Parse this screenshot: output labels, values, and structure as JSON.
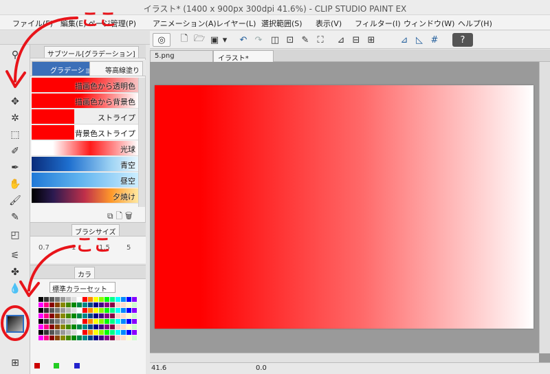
{
  "window": {
    "title": "イラスト* (1400 x 900px 300dpi 41.6%)  - CLIP STUDIO PAINT EX"
  },
  "menu": [
    "ファイル(F)",
    "編集(E)",
    "ページ管理(P)",
    "アニメーション(A)",
    "レイヤー(L)",
    "選択範囲(S)",
    "表示(V)",
    "フィルター(I)",
    "ウィンドウ(W)",
    "ヘルプ(H)"
  ],
  "subtool_panel": {
    "tab_label": "サブツール[グラデーション]",
    "groups": [
      "グラデーション",
      "等高線塗り"
    ],
    "items": [
      {
        "label": "描画色から透明色"
      },
      {
        "label": "描画色から背景色"
      },
      {
        "label": "ストライプ"
      },
      {
        "label": "背景色ストライプ"
      },
      {
        "label": "光球"
      },
      {
        "label": "青空"
      },
      {
        "label": "昼空"
      },
      {
        "label": "夕焼け"
      }
    ]
  },
  "brush_panel": {
    "tab_label": "ブラシサイズ",
    "sizes": [
      "0.7",
      "1",
      "1.5",
      "5"
    ]
  },
  "color_panel": {
    "tab_label": "カラ",
    "set_name": "標準カラーセット"
  },
  "documents": {
    "tabs": [
      "5.png",
      "イラスト*"
    ]
  },
  "status": {
    "zoom": "41.6",
    "rotation": "0.0"
  },
  "annotations": {
    "top": "ここ",
    "bottom": "ここ"
  },
  "colors": {
    "accent": "#e8141a",
    "foreground": "#ff0000",
    "background": "#ffffff"
  }
}
